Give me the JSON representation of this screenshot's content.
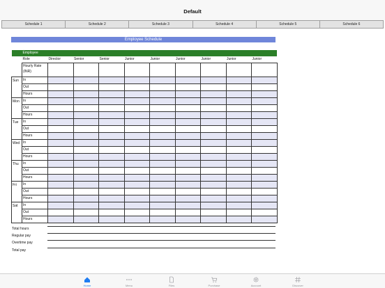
{
  "header": {
    "title": "Default"
  },
  "tabs": [
    "Schedule 1",
    "Schedule 2",
    "Schedule 3",
    "Schedule 4",
    "Schedule 5",
    "Schedule 6"
  ],
  "banner": "Employee Schedule",
  "table": {
    "section_label": "Employee",
    "role_label": "Role",
    "roles": [
      "Director",
      "Senior",
      "Senior",
      "Junior",
      "Junior",
      "Junior",
      "Junior",
      "Junior",
      "Junior"
    ],
    "rate_label": "Hourly Rate (INR)",
    "days": [
      "Sun",
      "Mon",
      "Tue",
      "Wed",
      "Thu",
      "Fri",
      "Sat"
    ],
    "row_labels": [
      "In",
      "Out",
      "Hours"
    ]
  },
  "totals": [
    "Total hours",
    "Regular pay",
    "Overtime pay",
    "Total pay"
  ],
  "bottom_nav": {
    "items": [
      {
        "label": "Home",
        "icon": "home-icon",
        "active": true
      },
      {
        "label": "Menu",
        "icon": "more-icon",
        "active": false
      },
      {
        "label": "Files",
        "icon": "file-icon",
        "active": false
      },
      {
        "label": "Purchase",
        "icon": "cart-icon",
        "active": false
      },
      {
        "label": "Account",
        "icon": "gear-icon",
        "active": false
      },
      {
        "label": "Discover",
        "icon": "hashtag-icon",
        "active": false
      }
    ],
    "active_color": "#1e7cf2",
    "inactive_color": "#8e8e93"
  }
}
